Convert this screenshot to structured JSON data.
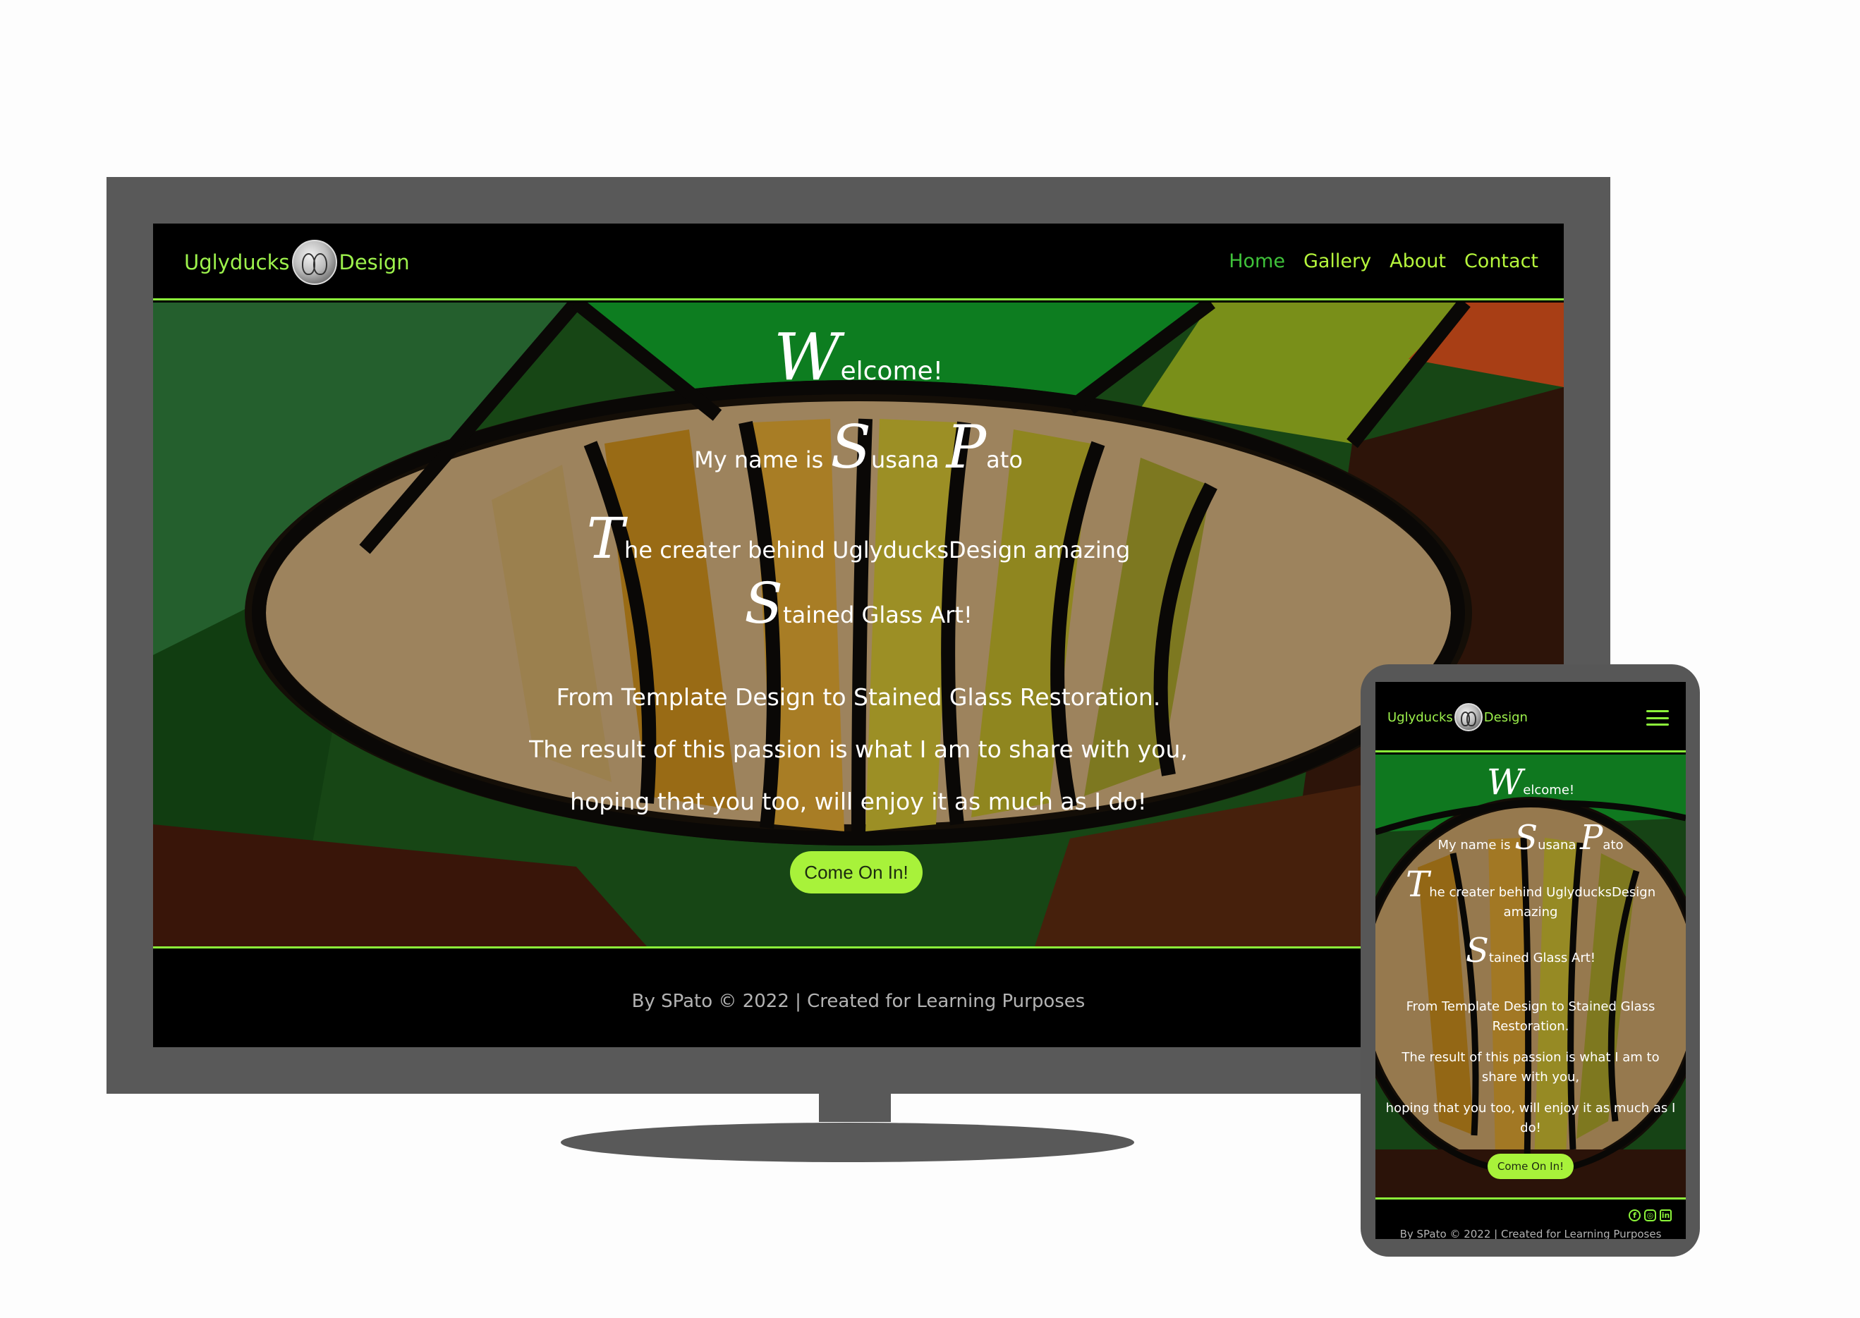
{
  "brand": {
    "left": "Uglyducks",
    "right": "Design"
  },
  "nav": {
    "items": [
      "Home",
      "Gallery",
      "About",
      "Contact"
    ],
    "active": "Home"
  },
  "hero": {
    "welcome_cap": "W",
    "welcome_rest": "elcome!",
    "name_prefix": "My name is ",
    "name_first_cap": "S",
    "name_first_rest": "usana ",
    "name_last_cap": "P",
    "name_last_rest": "ato",
    "creator_cap": "T",
    "creator_rest": "he creater behind UglyducksDesign amazing",
    "stained_cap": "S",
    "stained_rest": "tained Glass Art!",
    "p1": "From Template Design to Stained Glass Restoration.",
    "p2": "The result of this passion is what I am to share with you,",
    "p3": "hoping that you too, will enjoy it as much as I do!",
    "button": "Come On In!"
  },
  "footer": {
    "text": "By SPato © 2022 | Created for Learning Purposes"
  },
  "social": {
    "facebook": "f",
    "instagram": "◎",
    "linkedin": "in"
  },
  "colors": {
    "accent": "#8cf53a",
    "nav_link": "#b6f73c",
    "active_link": "#3fc23a",
    "button": "#a8f23a"
  }
}
